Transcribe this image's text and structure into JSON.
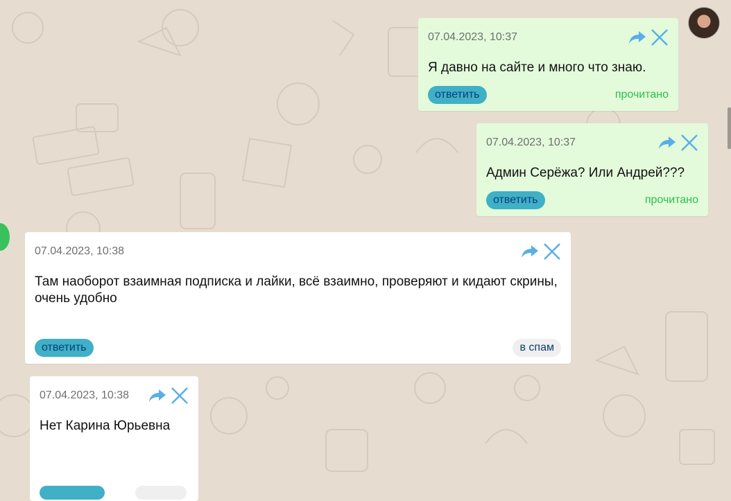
{
  "messages": [
    {
      "date": "07.04.2023, 10:37",
      "text": "Я давно на сайте и много что знаю.",
      "reply": "ответить",
      "status": "прочитано"
    },
    {
      "date": "07.04.2023, 10:37",
      "text": "Админ Серёжа? Или Андрей???",
      "reply": "ответить",
      "status": "прочитано"
    },
    {
      "date": "07.04.2023, 10:38",
      "text": "Там наоборот взаимная подписка и лайки, всё взаимно, проверяют и кидают скрины, очень удобно",
      "reply": "ответить",
      "spam": "в спам"
    },
    {
      "date": "07.04.2023, 10:38",
      "text": "Нет Карина Юрьевна"
    }
  ],
  "icons": {
    "forward": "share-arrow-icon",
    "close": "close-icon"
  },
  "colors": {
    "outgoing_bg": "#e3fbdb",
    "incoming_bg": "#ffffff",
    "reply_button": "#3fb0c6",
    "read_status": "#2bbd4a",
    "icon_blue": "#5aaee8"
  }
}
